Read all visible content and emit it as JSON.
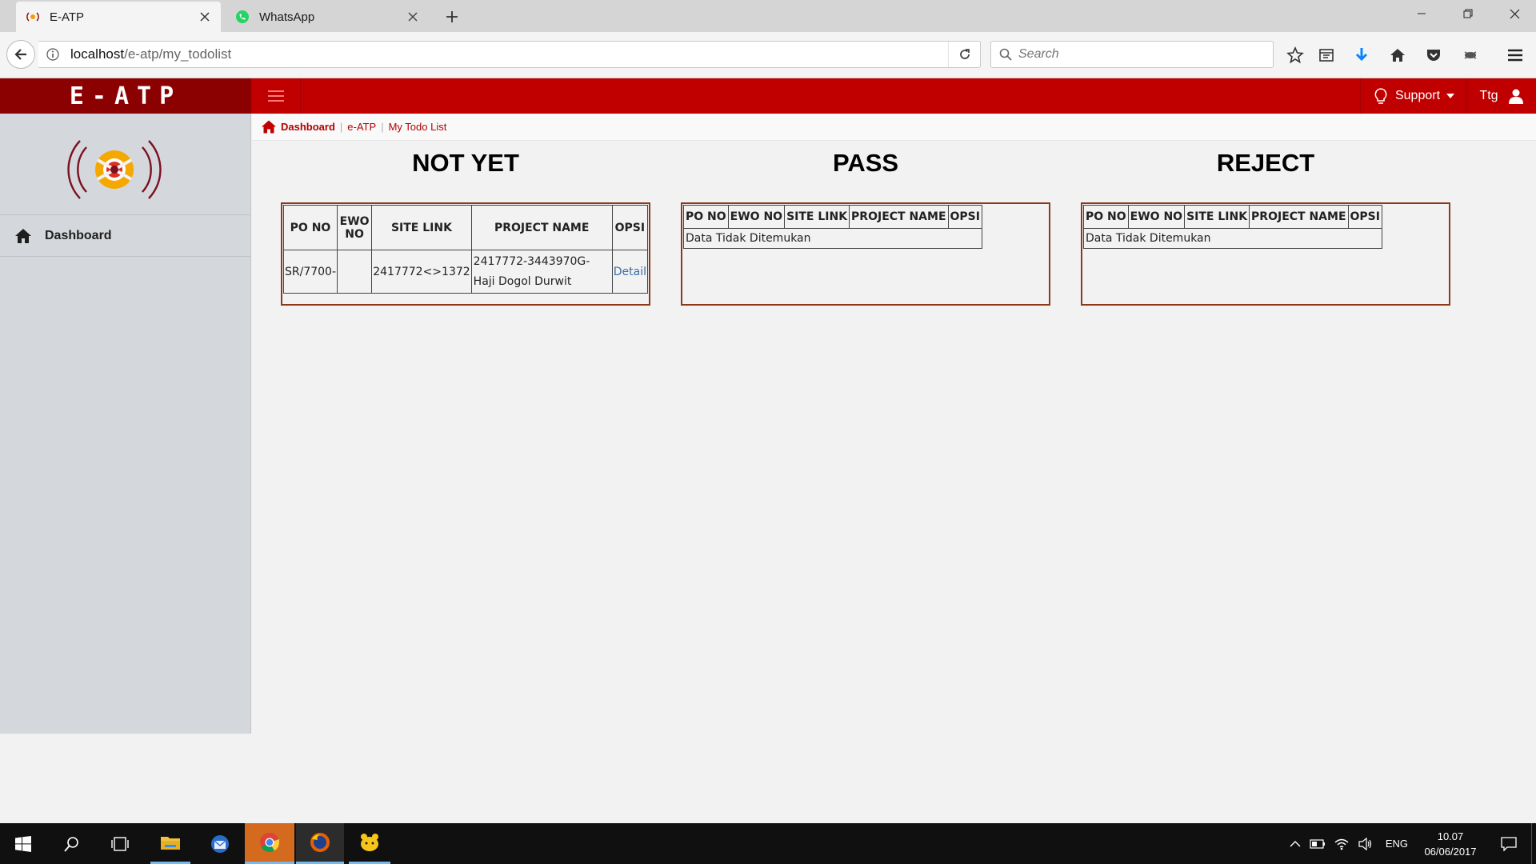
{
  "browser": {
    "tabs": [
      {
        "title": "E-ATP",
        "active": true
      },
      {
        "title": "WhatsApp",
        "active": false
      }
    ],
    "url_host": "localhost",
    "url_path": "/e-atp/my_todolist",
    "search_placeholder": "Search"
  },
  "app": {
    "brand": "E-ATP",
    "support_label": "Support",
    "user_label": "Ttg",
    "header_color": "#c00000",
    "brand_color": "#8b0000"
  },
  "sidebar": {
    "items": [
      {
        "label": "Dashboard",
        "icon": "home-icon"
      }
    ]
  },
  "breadcrumb": {
    "items": [
      "Dashboard",
      "e-ATP",
      "My Todo List"
    ]
  },
  "panels": {
    "not_yet": {
      "title": "NOT YET",
      "headers": [
        "PO NO",
        "EWO NO",
        "SITE LINK",
        "PROJECT NAME",
        "OPSI"
      ],
      "rows": [
        {
          "po_no": "SR/7700-",
          "ewo_no": "",
          "site_link": "2417772<>1372",
          "project_name": "2417772-3443970G-Haji Dogol Durwit",
          "opsi": "Detail"
        }
      ]
    },
    "pass": {
      "title": "PASS",
      "headers": [
        "PO NO",
        "EWO NO",
        "SITE LINK",
        "PROJECT NAME",
        "OPSI"
      ],
      "empty_text": "Data Tidak Ditemukan"
    },
    "reject": {
      "title": "REJECT",
      "headers": [
        "PO NO",
        "EWO NO",
        "SITE LINK",
        "PROJECT NAME",
        "OPSI"
      ],
      "empty_text": "Data Tidak Ditemukan"
    }
  },
  "taskbar": {
    "language": "ENG",
    "time": "10.07",
    "date": "06/06/2017"
  }
}
